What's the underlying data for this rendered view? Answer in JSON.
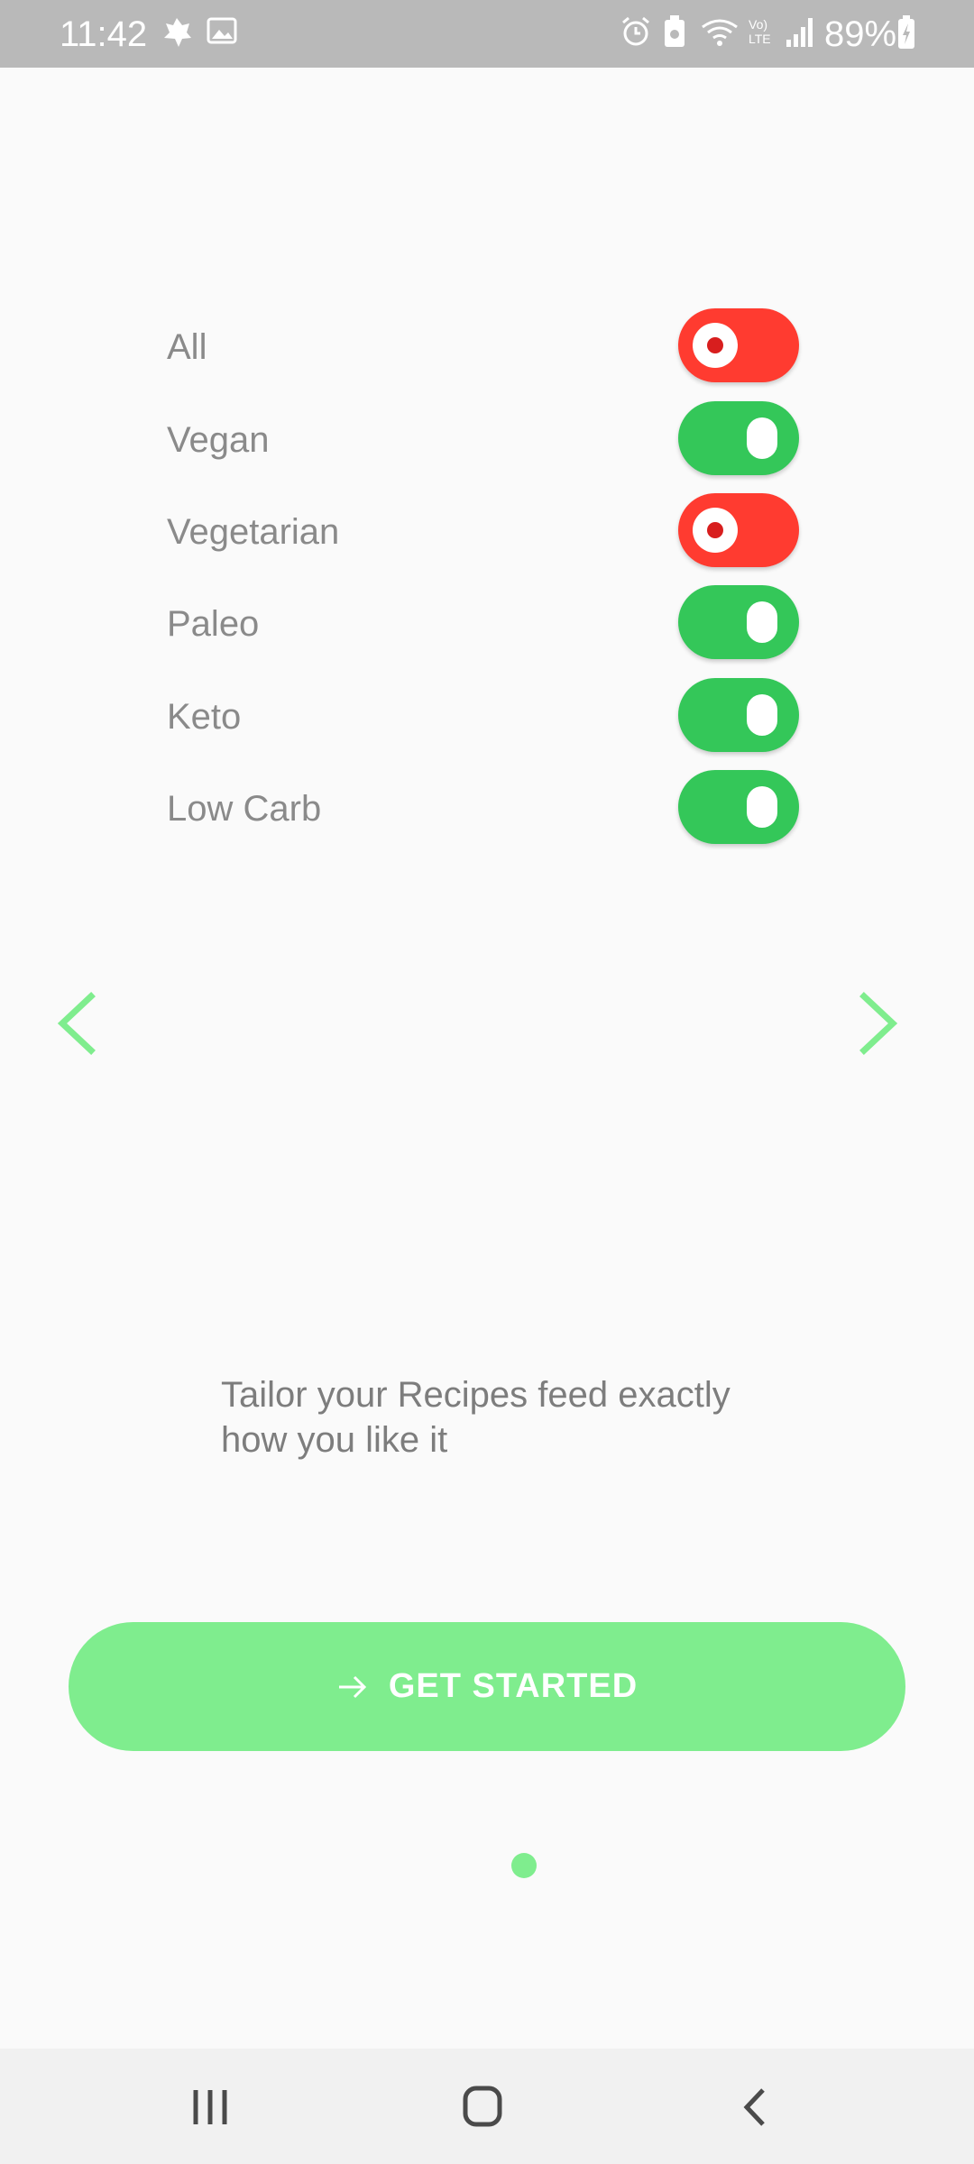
{
  "status_bar": {
    "time": "11:42",
    "battery": "89%",
    "icons": [
      "leaf-notification-icon",
      "image-notification-icon",
      "alarm-icon",
      "battery-saver-icon",
      "wifi-icon",
      "volte-icon",
      "signal-icon",
      "battery-charging-icon"
    ]
  },
  "preferences": [
    {
      "label": "All",
      "state": "off"
    },
    {
      "label": "Vegan",
      "state": "on"
    },
    {
      "label": "Vegetarian",
      "state": "off"
    },
    {
      "label": "Paleo",
      "state": "on"
    },
    {
      "label": "Keto",
      "state": "on"
    },
    {
      "label": "Low Carb",
      "state": "on"
    }
  ],
  "tagline": "Tailor your Recipes feed exactly how you like it",
  "cta": {
    "label": "GET STARTED",
    "icon": "arrow-right-icon"
  },
  "pager": {
    "current_page": 1,
    "total_pages": 1
  },
  "colors": {
    "accent_green": "#7fed8e",
    "switch_on": "#34c759",
    "switch_off": "#ff3b30"
  },
  "bottom_nav": {
    "icons": [
      "recent-apps-icon",
      "home-icon",
      "back-icon"
    ]
  }
}
